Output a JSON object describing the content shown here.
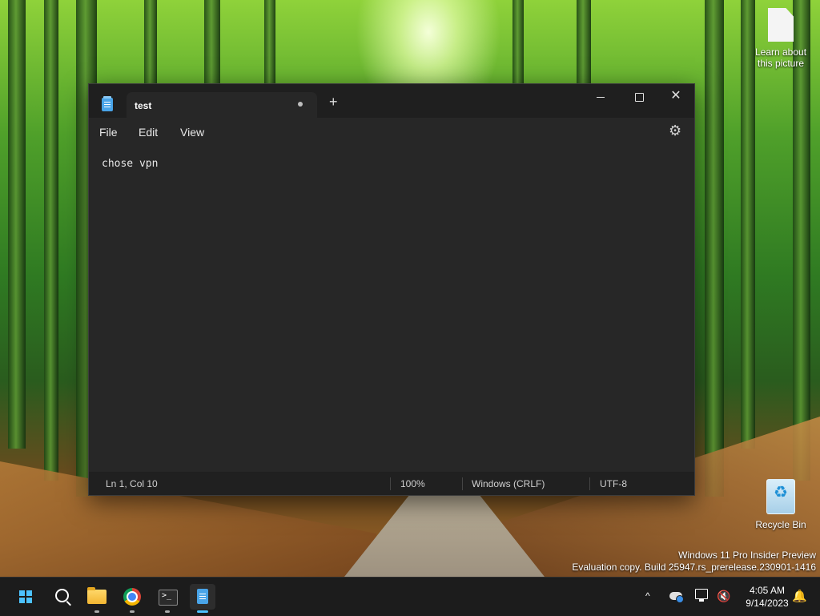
{
  "desktop": {
    "icons": [
      {
        "label": "Learn about this picture",
        "icon": "file-icon"
      },
      {
        "label": "Recycle Bin",
        "icon": "recycle-bin-icon"
      }
    ],
    "watermark": {
      "line1": "Windows 11 Pro Insider Preview",
      "line2": "Evaluation copy. Build 25947.rs_prerelease.230901-1416"
    }
  },
  "notepad": {
    "tab_title": "test",
    "new_tab_glyph": "+",
    "close_glyph": "✕",
    "menu": {
      "file": "File",
      "edit": "Edit",
      "view": "View"
    },
    "settings_glyph": "⚙",
    "content": "chose vpn",
    "status": {
      "position": "Ln 1, Col 10",
      "zoom": "100%",
      "line_ending": "Windows (CRLF)",
      "encoding": "UTF-8"
    }
  },
  "taskbar": {
    "apps": [
      "start-icon",
      "search-icon",
      "file-explorer-icon",
      "chrome-icon",
      "terminal-icon",
      "notepad-icon"
    ],
    "tray": {
      "chevron": "^",
      "volume_glyph": "🔇",
      "bell_glyph": "🔔",
      "time": "4:05 AM",
      "date": "9/14/2023"
    }
  },
  "colors": {
    "accent": "#4cc2ff",
    "window_bg": "#272727",
    "titlebar_bg": "#1f1f1f"
  }
}
